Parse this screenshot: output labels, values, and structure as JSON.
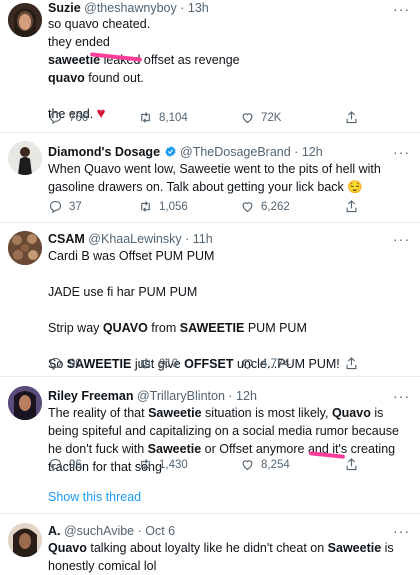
{
  "tweets": [
    {
      "name": "Suzie",
      "handle": "@theshawnyboy",
      "time": "13h",
      "body": [
        "so quavo cheated.",
        "they ended",
        "saweetie leaked offset as revenge",
        "quavo found out.",
        "",
        "the end."
      ],
      "heart_emoji": "♥",
      "replies": "766",
      "retweets": "8,104",
      "likes": "72K"
    },
    {
      "name": "Diamond's Dosage",
      "handle": "@TheDosageBrand",
      "time": "12h",
      "body": "When Quavo went low, Saweetie went to the pits of hell with gasoline drawers on. Talk about getting your lick back",
      "emoji": "😌",
      "replies": "37",
      "retweets": "1,056",
      "likes": "6,262"
    },
    {
      "name": "CSAM",
      "handle": "@KhaaLewinsky",
      "time": "11h",
      "body": [
        "Cardi B was Offset PUM PUM",
        "JADE use fi har PUM PUM",
        "Strip way QUAVO from SAWEETIE PUM PUM",
        "So SAWEETIE just give OFFSET uncle...PUM PUM!"
      ],
      "replies": "90",
      "retweets": "910",
      "likes": "4,774"
    },
    {
      "name": "Riley Freeman",
      "handle": "@TrillaryBlinton",
      "time": "12h",
      "body": "The reality of that Saweetie situation is most likely, Quavo is being spiteful and capitalizing on a social media rumor because he don't fuck with Saweetie or Offset anymore and it's creating traction for that song",
      "replies": "96",
      "retweets": "1,430",
      "likes": "8,254",
      "show_thread": "Show this thread"
    },
    {
      "name": "A.",
      "handle": "@suchAvibe",
      "time": "Oct 6",
      "body": "Quavo talking about loyalty like he didn't cheat on Saweetie is honestly comical lol"
    }
  ],
  "separator": "·",
  "more_icon": "more-horizontal-icon",
  "colors": {
    "link": "#1d9bf0",
    "muted": "#536471",
    "verified": "#1d9bf0",
    "heart": "#d4173b",
    "marker": "#ff3e9a"
  }
}
